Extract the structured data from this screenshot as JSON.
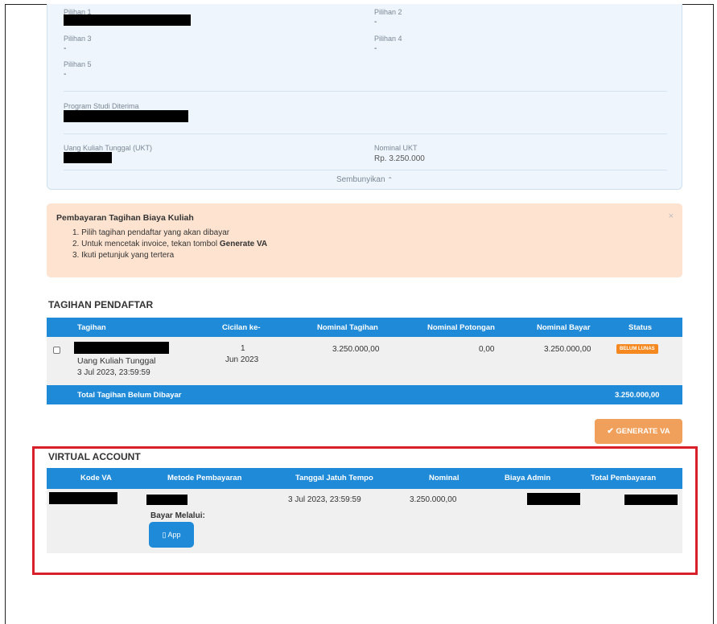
{
  "info": {
    "pilihan1_label": "Pilihan 1",
    "pilihan2_label": "Pilihan 2",
    "pilihan2_value": "-",
    "pilihan3_label": "Pilihan 3",
    "pilihan3_value": "-",
    "pilihan4_label": "Pilihan 4",
    "pilihan4_value": "-",
    "pilihan5_label": "Pilihan 5",
    "pilihan5_value": "-",
    "prodi_label": "Program Studi Diterima",
    "ukt_label": "Uang Kuliah Tunggal (UKT)",
    "nominal_ukt_label": "Nominal UKT",
    "nominal_ukt_value": "Rp. 3.250.000",
    "hide_toggle": "Sembunyikan",
    "hide_chevron": "⌃"
  },
  "alert": {
    "title": "Pembayaran Tagihan Biaya Kuliah",
    "close": "×",
    "step1": "1. Pilih tagihan pendaftar yang akan dibayar",
    "step2_prefix": "2. Untuk mencetak invoice, tekan tombol ",
    "step2_bold": "Generate VA",
    "step3": "3. Ikuti petunjuk yang tertera"
  },
  "tagihan": {
    "title": "TAGIHAN PENDAFTAR",
    "headers": [
      "Tagihan",
      "Cicilan ke-",
      "Nominal Tagihan",
      "Nominal Potongan",
      "Nominal Bayar",
      "Status"
    ],
    "row": {
      "name": "Uang Kuliah Tunggal",
      "date": "3 Jul 2023, 23:59:59",
      "cicilan": "1",
      "cicilan_month": "Jun 2023",
      "nominal_tagihan": "3.250.000,00",
      "nominal_potongan": "0,00",
      "nominal_bayar": "3.250.000,00",
      "status": "BELUM LUNAS"
    },
    "footer_label": "Total Tagihan Belum Dibayar",
    "footer_value": "3.250.000,00"
  },
  "generate_button": "GENERATE VA",
  "generate_icon": "✔",
  "va": {
    "title": "VIRTUAL ACCOUNT",
    "headers": [
      "Kode VA",
      "Metode Pembayaran",
      "Tanggal Jatuh Tempo",
      "Nominal",
      "Biaya Admin",
      "Total Pembayaran"
    ],
    "row": {
      "due_date": "3 Jul 2023, 23:59:59",
      "nominal": "3.250.000,00",
      "bayar_label": "Bayar Melalui:",
      "app_icon": "▯",
      "app_label": "App"
    }
  },
  "colors": {
    "table_header": "#1f8ad8",
    "badge": "#f5891f",
    "generate_button": "#f0a05a",
    "alert_bg": "#fde3d0",
    "highlight_box": "#d9202a"
  }
}
